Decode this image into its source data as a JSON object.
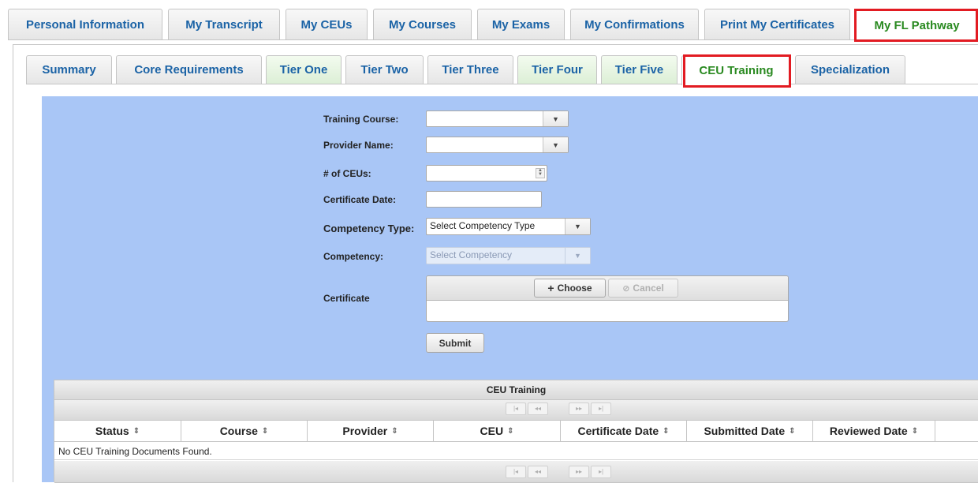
{
  "top_tabs": [
    {
      "label": "Personal Information",
      "selected": false
    },
    {
      "label": "My Transcript",
      "selected": false
    },
    {
      "label": "My CEUs",
      "selected": false
    },
    {
      "label": "My Courses",
      "selected": false
    },
    {
      "label": "My Exams",
      "selected": false
    },
    {
      "label": "My Confirmations",
      "selected": false
    },
    {
      "label": "Print My Certificates",
      "selected": false
    },
    {
      "label": "My FL Pathway",
      "selected": true
    }
  ],
  "sub_tabs": [
    {
      "label": "Summary",
      "selected": false
    },
    {
      "label": "Core Requirements",
      "selected": false
    },
    {
      "label": "Tier One",
      "selected": false
    },
    {
      "label": "Tier Two",
      "selected": false
    },
    {
      "label": "Tier Three",
      "selected": false
    },
    {
      "label": "Tier Four",
      "selected": false
    },
    {
      "label": "Tier Five",
      "selected": false
    },
    {
      "label": "CEU Training",
      "selected": true
    },
    {
      "label": "Specialization",
      "selected": false
    }
  ],
  "form": {
    "training_course_label": "Training Course:",
    "training_course_value": "",
    "provider_name_label": "Provider Name:",
    "provider_name_value": "",
    "ceus_label": "# of CEUs:",
    "ceus_value": "",
    "certificate_date_label": "Certificate Date:",
    "certificate_date_value": "",
    "competency_type_label": "Competency Type:",
    "competency_type_value": "Select Competency Type",
    "competency_label": "Competency:",
    "competency_value": "Select Competency",
    "certificate_label": "Certificate",
    "choose_label": "Choose",
    "cancel_label": "Cancel",
    "submit_label": "Submit"
  },
  "grid": {
    "title": "CEU Training",
    "columns": [
      "Status",
      "Course",
      "Provider",
      "CEU",
      "Certificate Date",
      "Submitted Date",
      "Reviewed Date"
    ],
    "empty_message": "No CEU Training Documents Found.",
    "pager_icons": [
      "first-page-icon",
      "prev-page-icon",
      "next-page-icon",
      "last-page-icon"
    ]
  },
  "colors": {
    "link_blue": "#1b63a6",
    "selected_green": "#2a8a21",
    "highlight_red": "#e21b22",
    "panel_blue": "#a9c6f6",
    "tier_tab_green": "#dcefd6"
  }
}
